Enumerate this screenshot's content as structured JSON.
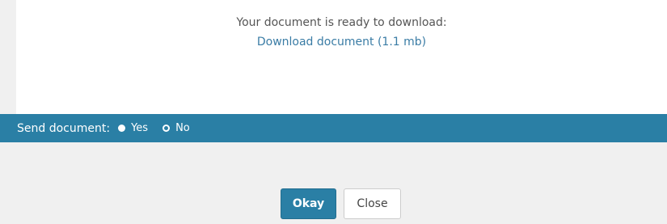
{
  "dialog": {
    "ready_text": "Your document is ready to download:",
    "download_link": "Download document (1.1 mb)"
  },
  "send_bar": {
    "label": "Send document:",
    "options": [
      {
        "label": "Yes",
        "selected": false
      },
      {
        "label": "No",
        "selected": true
      }
    ]
  },
  "buttons": {
    "okay_label": "Okay",
    "close_label": "Close"
  },
  "colors": {
    "accent": "#2a7fa5",
    "link": "#3a7ca5",
    "background": "#f0f0f0",
    "panel": "#ffffff"
  }
}
